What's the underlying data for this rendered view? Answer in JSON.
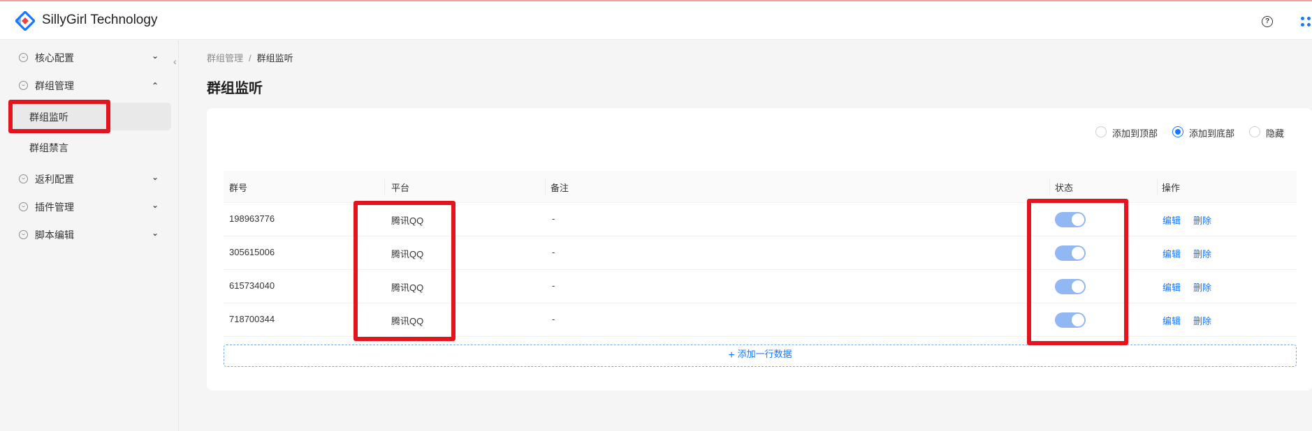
{
  "app": {
    "title": "SillyGirl Technology",
    "brand_color": "#1677ff"
  },
  "header": {
    "help_icon": "question-circle-icon",
    "apps_icon": "apps-grid-icon"
  },
  "sidebar": {
    "items": [
      {
        "label": "核心配置",
        "icon": "smile-icon",
        "arrow": "chevron-down-icon"
      },
      {
        "label": "群组管理",
        "icon": "smile-icon",
        "arrow": "chevron-up-icon",
        "expanded": true,
        "children": [
          {
            "label": "群组监听",
            "active": true
          },
          {
            "label": "群组禁言",
            "active": false
          }
        ]
      },
      {
        "label": "返利配置",
        "icon": "smile-icon",
        "arrow": "chevron-down-icon"
      },
      {
        "label": "插件管理",
        "icon": "smile-icon",
        "arrow": "chevron-down-icon"
      },
      {
        "label": "脚本编辑",
        "icon": "smile-icon",
        "arrow": "chevron-down-icon"
      }
    ]
  },
  "breadcrumb": {
    "parent": "群组管理",
    "separator": "/",
    "current": "群组监听"
  },
  "page": {
    "title": "群组监听"
  },
  "position_options": {
    "options": [
      "添加到顶部",
      "添加到底部",
      "隐藏"
    ],
    "selected": "添加到底部"
  },
  "table": {
    "columns": [
      "群号",
      "平台",
      "备注",
      "状态",
      "操作"
    ],
    "rows": [
      {
        "group_id": "198963776",
        "platform": "腾讯QQ",
        "note": "-",
        "enabled": true,
        "edit": "编辑",
        "delete": "删除"
      },
      {
        "group_id": "305615006",
        "platform": "腾讯QQ",
        "note": "-",
        "enabled": true,
        "edit": "编辑",
        "delete": "删除"
      },
      {
        "group_id": "615734040",
        "platform": "腾讯QQ",
        "note": "-",
        "enabled": true,
        "edit": "编辑",
        "delete": "删除"
      },
      {
        "group_id": "718700344",
        "platform": "腾讯QQ",
        "note": "-",
        "enabled": true,
        "edit": "编辑",
        "delete": "删除"
      }
    ],
    "add_row_label": "添加一行数据",
    "add_icon": "plus-icon"
  },
  "colors": {
    "highlight": "#e3141e",
    "switch_on": "#91b8f5",
    "link": "#1677ff"
  }
}
